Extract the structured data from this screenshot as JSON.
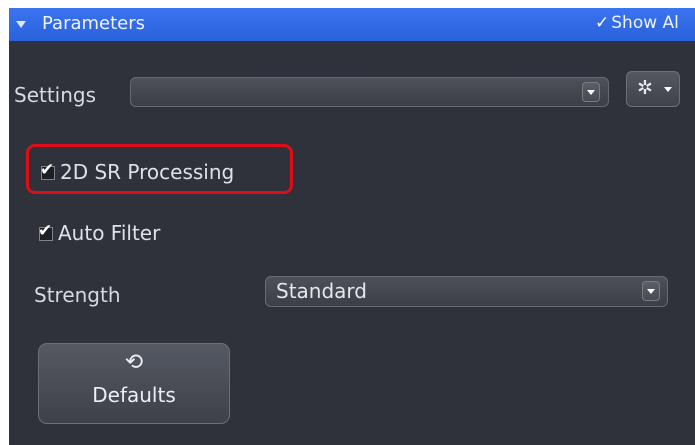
{
  "header": {
    "title": "Parameters",
    "show_all_label": "Show Al"
  },
  "settings": {
    "label": "Settings",
    "value": ""
  },
  "options": {
    "sr_processing": {
      "label": "2D SR Processing",
      "checked": true
    },
    "auto_filter": {
      "label": "Auto Filter",
      "checked": true
    }
  },
  "strength": {
    "label": "Strength",
    "value": "Standard"
  },
  "defaults_button": {
    "label": "Defaults"
  },
  "icons": {
    "expand": "triangle-down-icon",
    "show_all_check": "checkmark-icon",
    "settings_gear": "gear-icon",
    "undo": "undo-icon"
  },
  "colors": {
    "header": "#2f6ae6",
    "panel": "#2f323b",
    "highlight": "#e00d18"
  }
}
